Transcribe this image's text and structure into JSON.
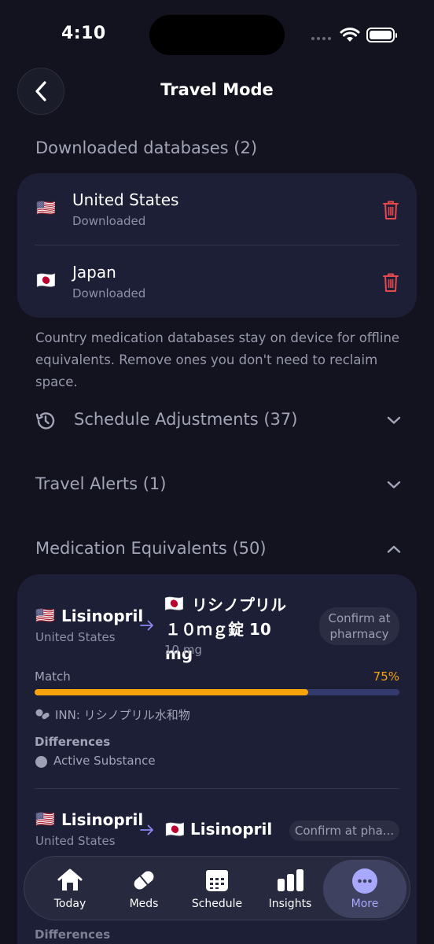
{
  "status_bar": {
    "time": "4:10"
  },
  "header": {
    "title": "Travel Mode"
  },
  "downloaded": {
    "title": "Downloaded databases (2)",
    "items": [
      {
        "flag": "🇺🇸",
        "name": "United States",
        "status": "Downloaded"
      },
      {
        "flag": "🇯🇵",
        "name": "Japan",
        "status": "Downloaded"
      }
    ],
    "info": "Country medication databases stay on device for offline equivalents. Remove ones you don't need to reclaim space."
  },
  "sections": {
    "schedule_adjustments": "Schedule Adjustments (37)",
    "travel_alerts": "Travel Alerts (1)",
    "medication_equivalents": "Medication Equivalents (50)"
  },
  "equivalents": [
    {
      "source_flag": "🇺🇸",
      "source_name": "Lisinopril",
      "source_country": "United States",
      "target_flag": "🇯🇵",
      "target_name": "リシノプリル １０ｍｇ錠 10 mg",
      "target_dose": "10 mg",
      "confirm_label": "Confirm at pharmacy",
      "match_label": "Match",
      "match_percent_text": "75%",
      "match_fraction": 0.75,
      "inn": "INN: リシノプリル水和物",
      "differences_title": "Differences",
      "difference_item": "Active Substance"
    },
    {
      "source_flag": "🇺🇸",
      "source_name": "Lisinopril",
      "source_country": "United States",
      "target_flag": "🇯🇵",
      "target_name": "Lisinopril",
      "confirm_label": "Confirm at pha...",
      "differences_title": "Differences"
    }
  ],
  "tabbar": {
    "items": [
      {
        "label": "Today",
        "icon": "house-icon"
      },
      {
        "label": "Meds",
        "icon": "pill-icon"
      },
      {
        "label": "Schedule",
        "icon": "calendar-icon"
      },
      {
        "label": "Insights",
        "icon": "bar-chart-icon"
      },
      {
        "label": "More",
        "icon": "ellipsis-icon"
      }
    ],
    "active": "More"
  },
  "colors": {
    "background": "#13131f",
    "card": "#1d1f36",
    "accent": "#a9a8ff",
    "danger": "#e5484d",
    "match_bar": "#f5a40c",
    "match_text": "#f5a40c"
  }
}
